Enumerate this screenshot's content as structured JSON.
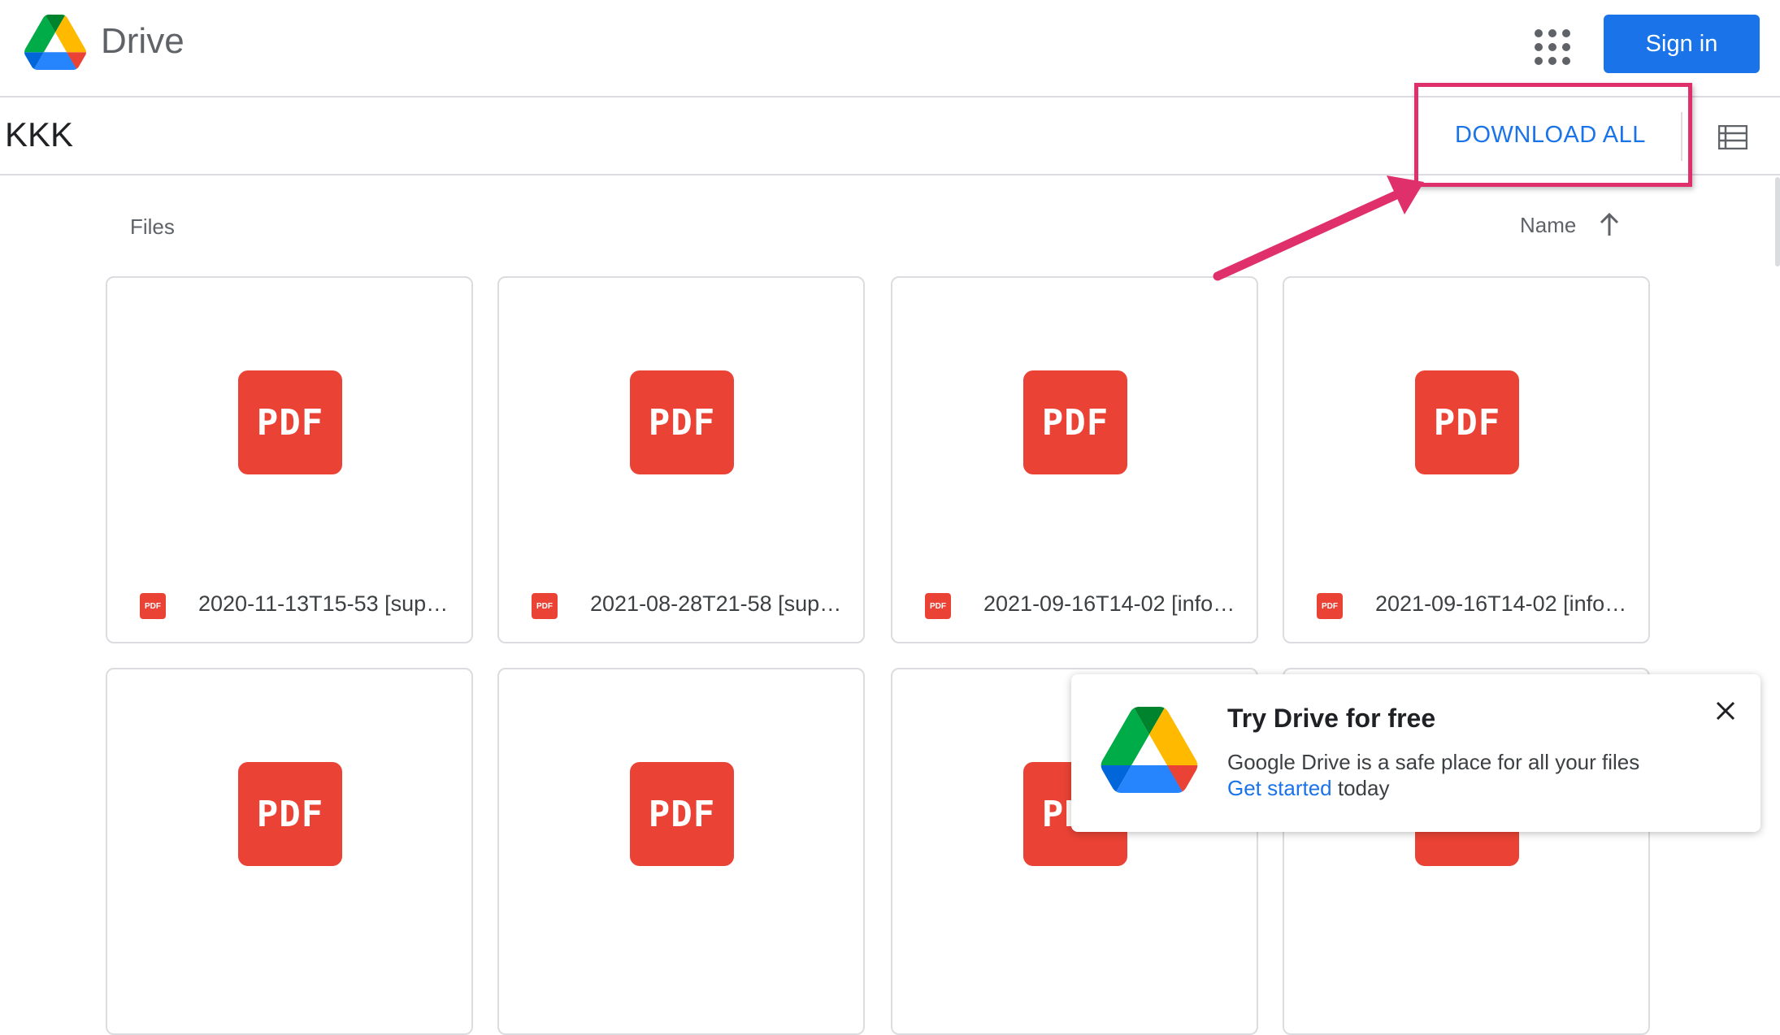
{
  "header": {
    "brand": "Drive",
    "sign_in_label": "Sign in"
  },
  "folder": {
    "title": "KKK",
    "download_all_label": "DOWNLOAD ALL"
  },
  "files_section": {
    "label": "Files",
    "sort_label": "Name"
  },
  "files": [
    {
      "name": "2020-11-13T15-53 [supp…",
      "thumb": "PDF",
      "icon": "PDF"
    },
    {
      "name": "2021-08-28T21-58 [supp…",
      "thumb": "PDF",
      "icon": "PDF"
    },
    {
      "name": "2021-09-16T14-02 [info…",
      "thumb": "PDF",
      "icon": "PDF"
    },
    {
      "name": "2021-09-16T14-02 [info…",
      "thumb": "PDF",
      "icon": "PDF"
    },
    {
      "thumb": "PDF"
    },
    {
      "thumb": "PDF"
    },
    {
      "thumb": "PDF"
    },
    {
      "thumb": "PDF"
    }
  ],
  "toast": {
    "title": "Try Drive for free",
    "body": "Google Drive is a safe place for all your files",
    "link": "Get started",
    "link_suffix": " today"
  },
  "colors": {
    "accent": "#1a73e8",
    "pdf_red": "#ea4335",
    "annotation": "#e0306c"
  }
}
